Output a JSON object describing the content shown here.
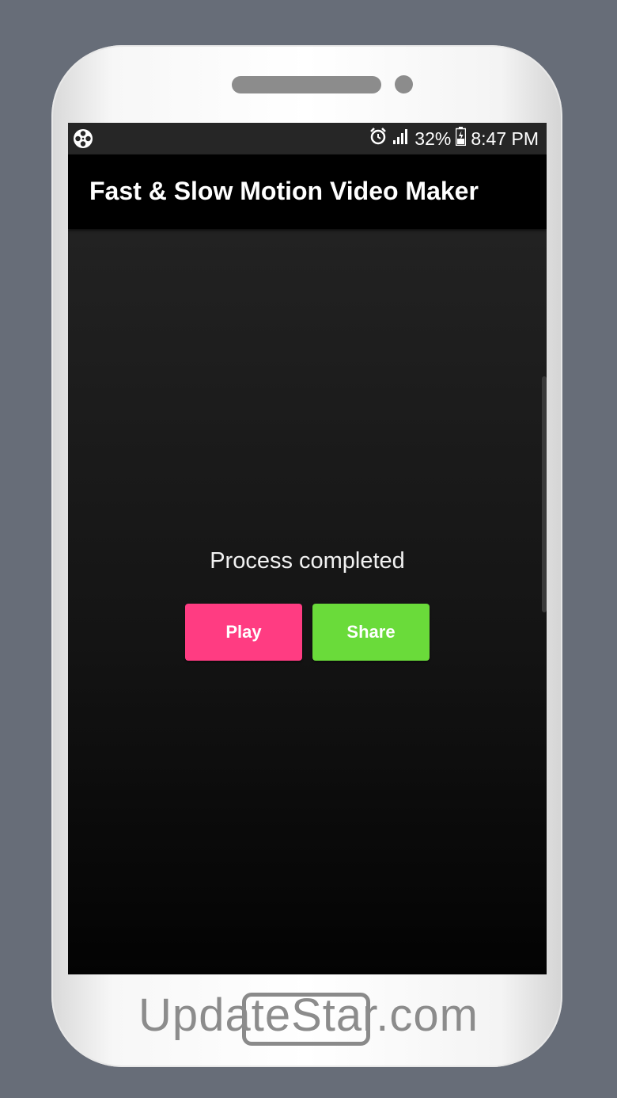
{
  "status_bar": {
    "app_icon": "film-reel-icon",
    "alarm_icon": "alarm-clock-icon",
    "signal_icon": "signal-bars-icon",
    "battery_percent": "32%",
    "battery_icon": "battery-charging-icon",
    "time": "8:47 PM"
  },
  "app_bar": {
    "title": "Fast & Slow Motion Video Maker"
  },
  "main": {
    "message": "Process completed",
    "play_label": "Play",
    "share_label": "Share"
  },
  "watermark": "UpdateStar.com",
  "colors": {
    "play": "#ff3c82",
    "share": "#6adb3a",
    "app_bar": "#000000",
    "status_bar": "#262626"
  }
}
